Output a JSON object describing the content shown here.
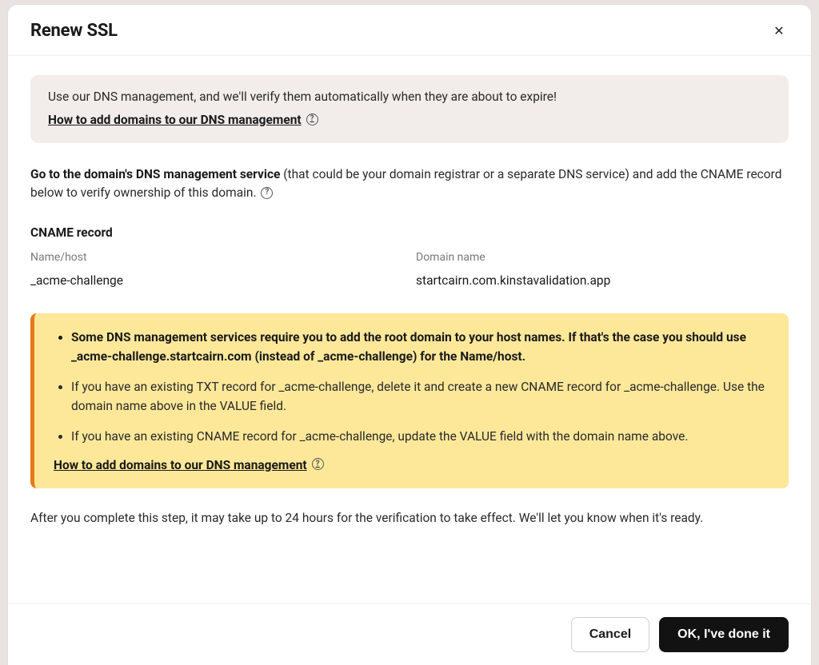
{
  "modal": {
    "title": "Renew SSL",
    "close_glyph": "✕"
  },
  "info_box": {
    "text": "Use our DNS management, and we'll verify them automatically when they are about to expire!",
    "link_text": "How to add domains to our DNS management"
  },
  "instruction": {
    "bold_prefix": "Go to the domain's DNS management service",
    "rest": " (that could be your domain registrar or a separate DNS service) and add the CNAME record below to verify ownership of this domain. "
  },
  "cname": {
    "section_title": "CNAME record",
    "name_label": "Name/host",
    "domain_label": "Domain name",
    "name_value": "_acme-challenge",
    "domain_value": "startcairn.com.kinstavalidation.app"
  },
  "warning": {
    "item1_prefix": "Some DNS management services require you to add the root domain to your host names. If that's the case you should use ",
    "item1_value": "_acme-challenge.startcairn.com",
    "item1_suffix": " (instead of _acme-challenge) for the Name/host.",
    "item2": "If you have an existing TXT record for _acme-challenge, delete it and create a new CNAME record for _acme-challenge. Use the domain name above in the VALUE field.",
    "item3": "If you have an existing CNAME record for _acme-challenge, update the VALUE field with the domain name above.",
    "link_text": "How to add domains to our DNS management"
  },
  "after_text": "After you complete this step, it may take up to 24 hours for the verification to take effect. We'll let you know when it's ready.",
  "footer": {
    "cancel": "Cancel",
    "confirm": "OK, I've done it"
  },
  "help_glyph": "?"
}
